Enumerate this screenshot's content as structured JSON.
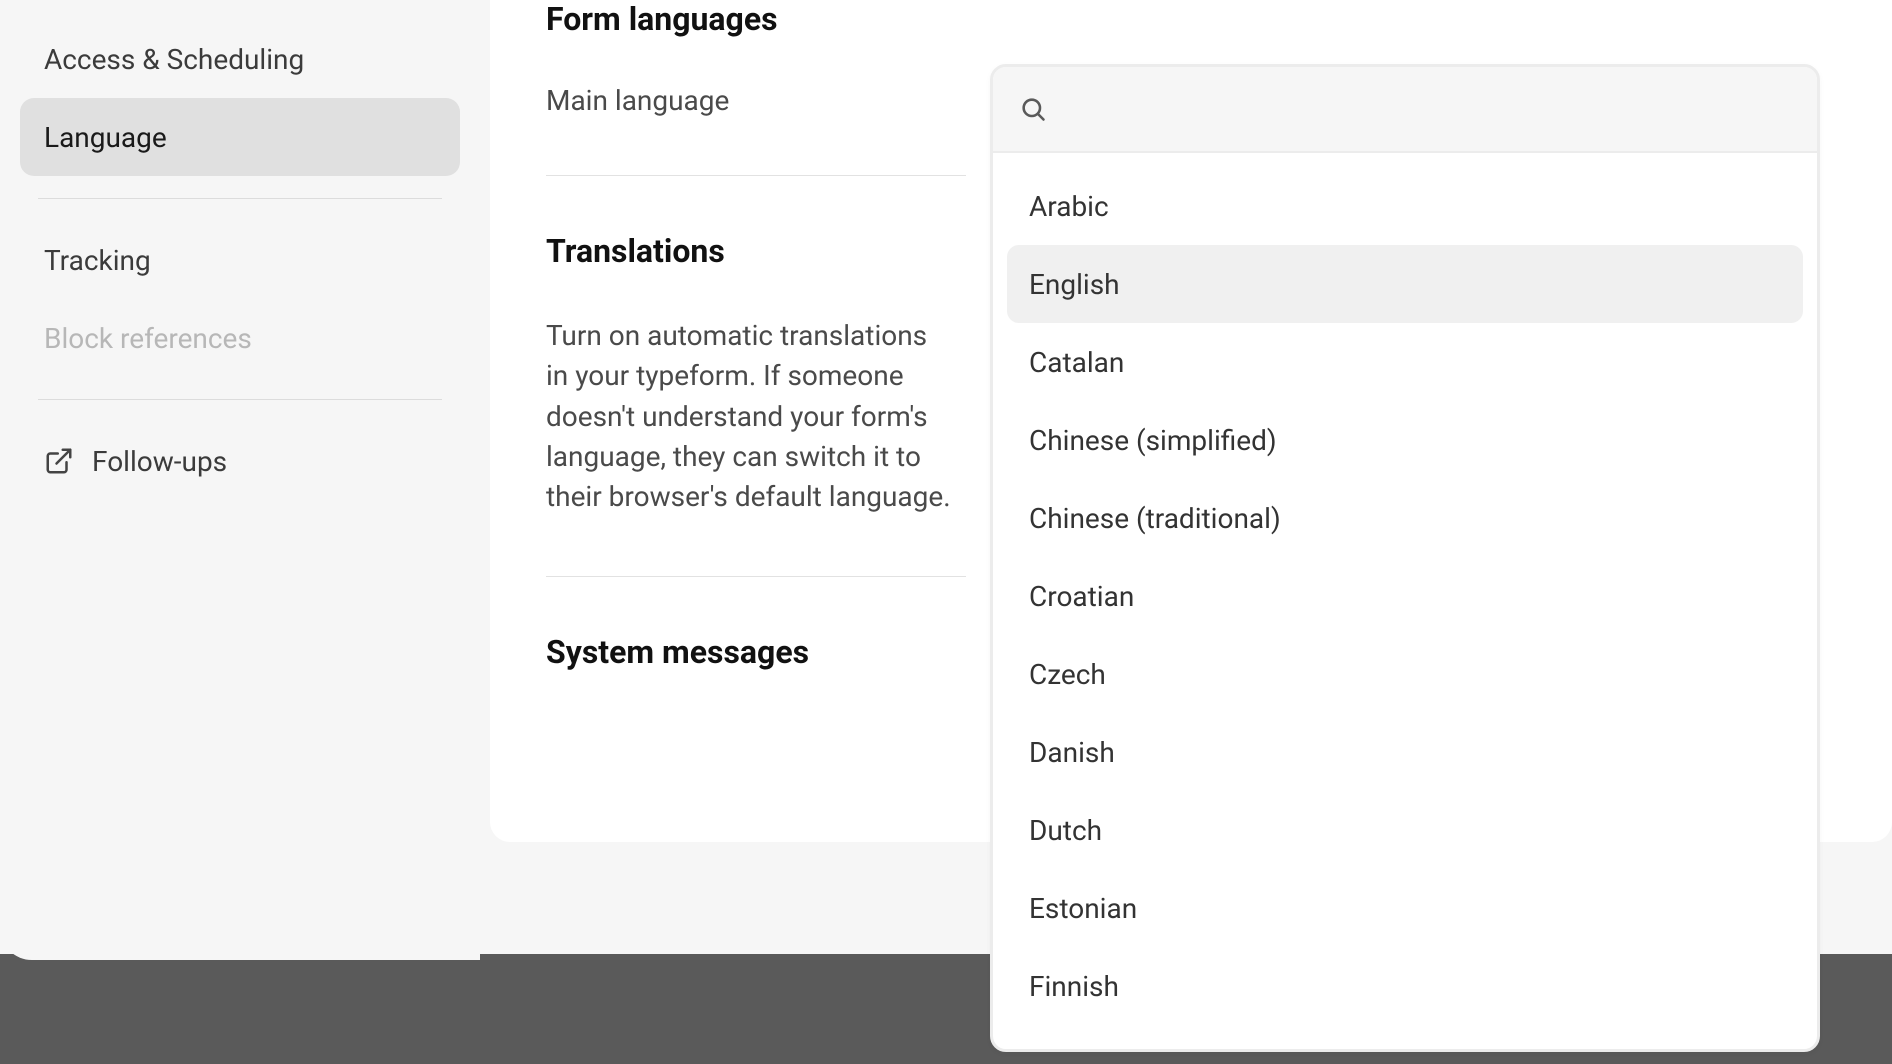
{
  "sidebar": {
    "items": [
      {
        "label": "Access & Scheduling",
        "active": false,
        "disabled": false
      },
      {
        "label": "Language",
        "active": true,
        "disabled": false
      },
      {
        "label": "Tracking",
        "active": false,
        "disabled": false
      },
      {
        "label": "Block references",
        "active": false,
        "disabled": true
      },
      {
        "label": "Follow-ups",
        "active": false,
        "disabled": false
      }
    ]
  },
  "main": {
    "form_languages_title": "Form languages",
    "main_language_label": "Main language",
    "translations_title": "Translations",
    "translations_desc": "Turn on automatic translations in your typeform. If someone doesn't understand your form's language, they can switch it to their browser's default language.",
    "system_messages_title": "System messages"
  },
  "dropdown": {
    "search_placeholder": "",
    "selected": "English",
    "options": [
      "Arabic",
      "English",
      "Catalan",
      "Chinese (simplified)",
      "Chinese (traditional)",
      "Croatian",
      "Czech",
      "Danish",
      "Dutch",
      "Estonian",
      "Finnish"
    ]
  }
}
